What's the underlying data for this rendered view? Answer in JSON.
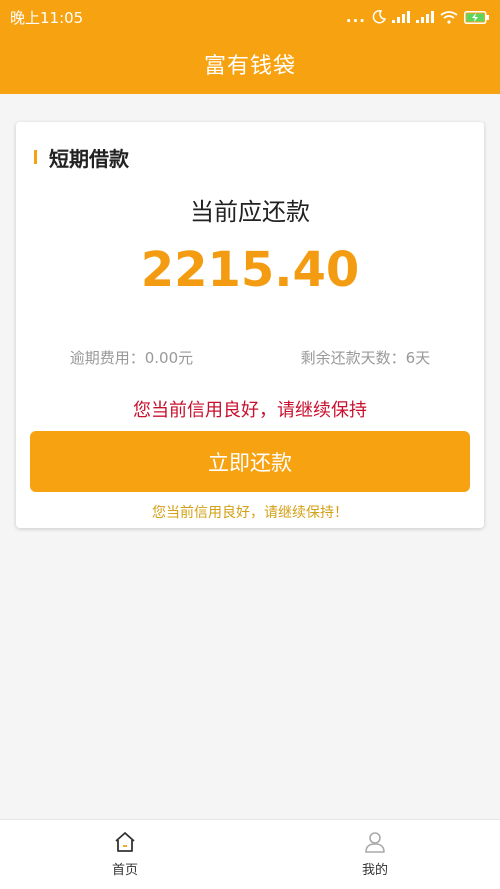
{
  "status_bar": {
    "time": "晚上11:05",
    "dots": "...",
    "icons": [
      "moon-icon",
      "signal-icon",
      "signal-icon",
      "wifi-icon",
      "battery-charging-icon"
    ]
  },
  "header": {
    "title": "富有钱袋"
  },
  "card": {
    "title": "短期借款",
    "due_label": "当前应还款",
    "due_amount": "2215.40",
    "overdue_fee": "逾期费用：0.00元",
    "days_remaining": "剩余还款天数：6天",
    "credit_message": "您当前信用良好，请继续保持",
    "repay_button": "立即还款",
    "credit_message_footer": "您当前信用良好，请继续保持！"
  },
  "tab_bar": {
    "tabs": [
      {
        "label": "首页",
        "icon": "home-icon"
      },
      {
        "label": "我的",
        "icon": "user-icon"
      }
    ]
  },
  "colors": {
    "brand": "#f7a211",
    "amount": "#f39c12",
    "alert_red": "#c8102e",
    "footer_note": "#d4a017"
  }
}
